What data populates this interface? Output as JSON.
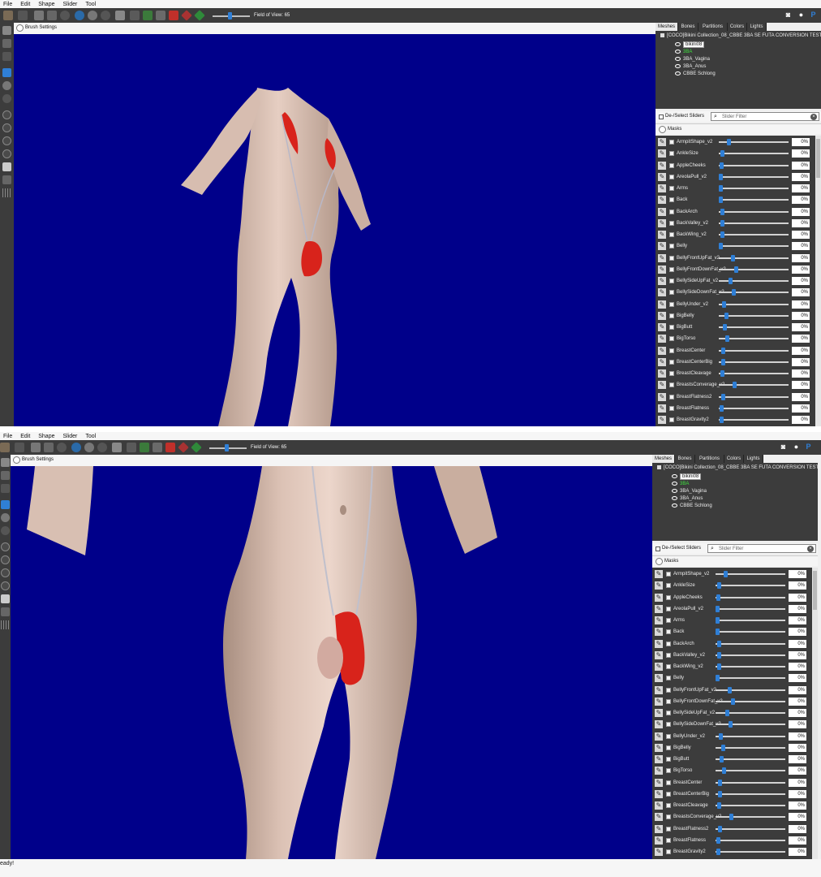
{
  "menu": [
    "File",
    "Edit",
    "Shape",
    "Slider",
    "Tool"
  ],
  "toolbar": {
    "fov_label": "Field of View: 65",
    "fov_value": 65
  },
  "brush_settings_label": "Brush Settings",
  "tabs": [
    "Meshes",
    "Bones",
    "Partitions",
    "Colors",
    "Lights"
  ],
  "active_tab": "Meshes",
  "mesh_tree": {
    "root": "[COCO]Bikini Collection_08_CBBE 3BA SE FUTA CONVERSION TEST",
    "items": [
      {
        "label": "bikini08",
        "state": "selected"
      },
      {
        "label": "3BA",
        "state": "green"
      },
      {
        "label": "3BA_Vagina",
        "state": "normal"
      },
      {
        "label": "3BA_Anus",
        "state": "normal"
      },
      {
        "label": "CBBE Schlong",
        "state": "normal"
      }
    ]
  },
  "slider_header": {
    "deselect_label": "De-/Select Sliders",
    "filter_placeholder": "Slider Filter"
  },
  "masks_label": "Masks",
  "sliders": [
    {
      "name": "ArmpitShape_v2",
      "value": "0%",
      "pos": 0.12
    },
    {
      "name": "AnkleSize",
      "value": "0%",
      "pos": 0.02
    },
    {
      "name": "AppleCheeks",
      "value": "0%",
      "pos": 0.01
    },
    {
      "name": "AreolaPull_v2",
      "value": "0%",
      "pos": 0.0
    },
    {
      "name": "Arms",
      "value": "0%",
      "pos": 0.0
    },
    {
      "name": "Back",
      "value": "0%",
      "pos": 0.0
    },
    {
      "name": "BackArch",
      "value": "0%",
      "pos": 0.02
    },
    {
      "name": "BackValley_v2",
      "value": "0%",
      "pos": 0.02
    },
    {
      "name": "BackWing_v2",
      "value": "0%",
      "pos": 0.02
    },
    {
      "name": "Belly",
      "value": "0%",
      "pos": 0.0
    },
    {
      "name": "BellyFrontUpFat_v2",
      "value": "0%",
      "pos": 0.17
    },
    {
      "name": "BellyFrontDownFat_v2",
      "value": "0%",
      "pos": 0.22
    },
    {
      "name": "BellySideUpFat_v2",
      "value": "0%",
      "pos": 0.14
    },
    {
      "name": "BellySideDownFat_v2",
      "value": "0%",
      "pos": 0.19
    },
    {
      "name": "BellyUnder_v2",
      "value": "0%",
      "pos": 0.05
    },
    {
      "name": "BigBelly",
      "value": "0%",
      "pos": 0.08
    },
    {
      "name": "BigButt",
      "value": "0%",
      "pos": 0.06
    },
    {
      "name": "BigTorso",
      "value": "0%",
      "pos": 0.09
    },
    {
      "name": "BreastCenter",
      "value": "0%",
      "pos": 0.03
    },
    {
      "name": "BreastCenterBig",
      "value": "0%",
      "pos": 0.03
    },
    {
      "name": "BreastCleavage",
      "value": "0%",
      "pos": 0.02
    },
    {
      "name": "BreastsConverage_v2",
      "value": "0%",
      "pos": 0.2
    },
    {
      "name": "BreastFlatness2",
      "value": "0%",
      "pos": 0.03
    },
    {
      "name": "BreastFlatness",
      "value": "0%",
      "pos": 0.01
    },
    {
      "name": "BreastGravity2",
      "value": "0%",
      "pos": 0.01
    }
  ],
  "status": "eady!",
  "colors": {
    "viewport": "#00008a",
    "panel_dark": "#3c3c3c",
    "accent": "#2f7fd6",
    "skin": "#e0c6b8",
    "garment": "#d8231b"
  }
}
